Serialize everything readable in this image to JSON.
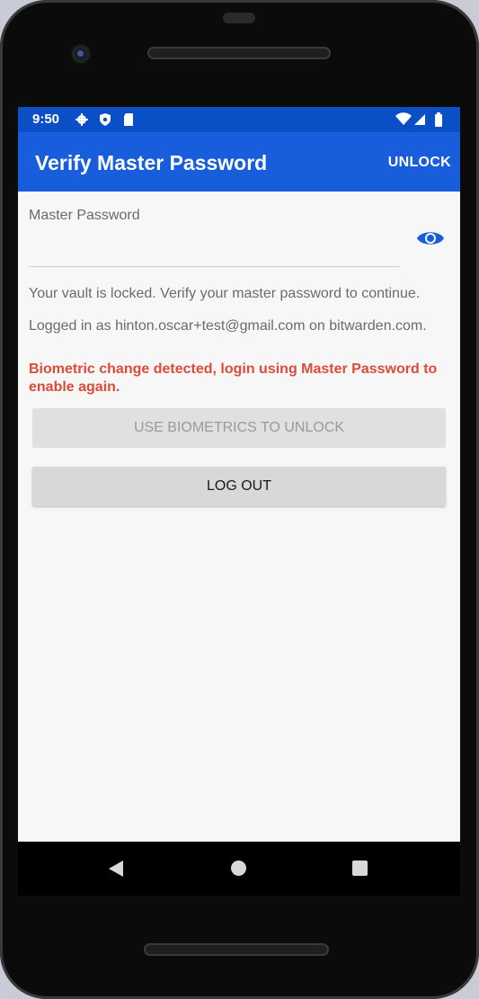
{
  "status_bar": {
    "time": "9:50",
    "icons": [
      "gear-icon",
      "shield-icon",
      "sd-card-icon",
      "wifi-icon",
      "signal-icon",
      "battery-icon"
    ]
  },
  "app_bar": {
    "title": "Verify Master Password",
    "action_label": "UNLOCK"
  },
  "form": {
    "password_label": "Master Password",
    "password_value": "",
    "toggle_icon": "eye-icon"
  },
  "messages": {
    "locked": "Your vault is locked. Verify your master password to continue.",
    "logged_in": "Logged in as hinton.oscar+test@gmail.com on bitwarden.com.",
    "error": "Biometric change detected, login using Master Password to enable again."
  },
  "buttons": {
    "biometrics": "USE BIOMETRICS TO UNLOCK",
    "logout": "LOG OUT"
  },
  "nav": {
    "icons": [
      "back-icon",
      "home-icon",
      "recents-icon"
    ]
  },
  "colors": {
    "status_bar": "#0b4fc7",
    "app_bar": "#175ddc",
    "accent": "#175ddc",
    "error": "#dd4b39"
  }
}
